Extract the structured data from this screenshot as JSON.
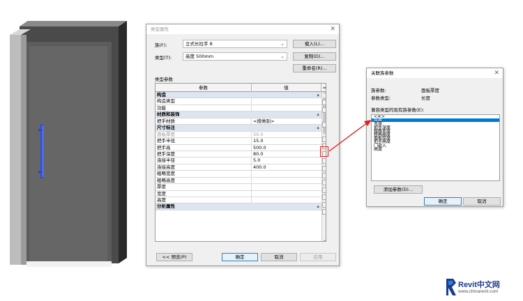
{
  "type_props": {
    "title": "类型属性",
    "family_label": "族(F):",
    "family_value": "立式长拉手 8",
    "type_label": "类型(T):",
    "type_value": "高度 500mm",
    "load_btn": "载入(L)...",
    "dup_btn": "复制(D)...",
    "rename_btn": "重命名(R)...",
    "section_label": "类型参数",
    "col_param": "参数",
    "col_value": "值",
    "col_eq": "=",
    "rows": [
      {
        "kind": "group",
        "name": "构造"
      },
      {
        "kind": "row",
        "name": "构造类型",
        "value": ""
      },
      {
        "kind": "row",
        "name": "功能",
        "value": ""
      },
      {
        "kind": "group",
        "name": "材质和装饰"
      },
      {
        "kind": "row",
        "name": "把手材质",
        "value": "<按类别>"
      },
      {
        "kind": "group",
        "name": "尺寸标注"
      },
      {
        "kind": "row",
        "name": "面板厚度",
        "value": "50.0",
        "gray": true
      },
      {
        "kind": "row",
        "name": "把手半径",
        "value": "15.0"
      },
      {
        "kind": "row",
        "name": "把手高",
        "value": "500.0"
      },
      {
        "kind": "row",
        "name": "把手深度",
        "value": "80.0"
      },
      {
        "kind": "row",
        "name": "连接半径",
        "value": "5.0"
      },
      {
        "kind": "row",
        "name": "连接高度",
        "value": "400.0"
      },
      {
        "kind": "row",
        "name": "粗略宽度",
        "value": ""
      },
      {
        "kind": "row",
        "name": "粗略高度",
        "value": ""
      },
      {
        "kind": "row",
        "name": "厚度",
        "value": ""
      },
      {
        "kind": "row",
        "name": "宽度",
        "value": ""
      },
      {
        "kind": "row",
        "name": "高度",
        "value": ""
      },
      {
        "kind": "group",
        "name": "分析属性"
      }
    ],
    "preview_btn": "<< 预览(P)",
    "ok_btn": "确定",
    "cancel_btn": "取消",
    "apply_btn": "应用"
  },
  "assoc_dlg": {
    "title": "关联族参数",
    "family_param_label": "族参数:",
    "family_param_value": "面板厚度",
    "param_type_label": "参数类型:",
    "param_type_value": "长度",
    "compatible_label": "兼容类型的现有族参数(E):",
    "items": [
      "<无>",
      "厚度",
      "宽度",
      "把手深度",
      "粗略宽度",
      "粗略高度",
      "面板厚度",
      "把手高度",
      "门嵌入",
      "高度"
    ],
    "add_param_btn": "添加参数(D)...",
    "ok_btn": "确定",
    "cancel_btn": "取消"
  },
  "logo": {
    "brand": "Revit中文网",
    "site": "www.chinarevit.com"
  }
}
